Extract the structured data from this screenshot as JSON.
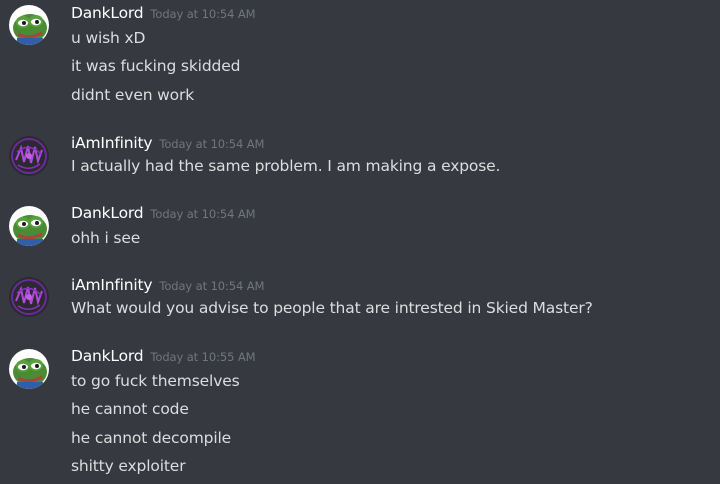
{
  "colors": {
    "background": "#36393f",
    "username": "#ffffff",
    "timestamp": "#72767d",
    "text": "#dcddde"
  },
  "messages": [
    {
      "author": "DankLord",
      "avatar_icon": "pepe-frog-avatar-icon",
      "timestamp": "Today at 10:54 AM",
      "lines": [
        "u wish xD",
        "it was fucking skidded",
        "didnt even work"
      ]
    },
    {
      "author": "iAmInfinity",
      "avatar_icon": "purple-logo-avatar-icon",
      "timestamp": "Today at 10:54 AM",
      "lines": [
        "I actually had the same problem. I am making a expose."
      ]
    },
    {
      "author": "DankLord",
      "avatar_icon": "pepe-frog-avatar-icon",
      "timestamp": "Today at 10:54 AM",
      "lines": [
        "ohh i see"
      ]
    },
    {
      "author": "iAmInfinity",
      "avatar_icon": "purple-logo-avatar-icon",
      "timestamp": "Today at 10:54 AM",
      "lines": [
        "What would you advise to people that are intrested in Skied Master?"
      ]
    },
    {
      "author": "DankLord",
      "avatar_icon": "pepe-frog-avatar-icon",
      "timestamp": "Today at 10:55 AM",
      "lines": [
        "to go fuck themselves",
        "he cannot code",
        "he cannot decompile",
        "shitty exploiter"
      ]
    }
  ]
}
